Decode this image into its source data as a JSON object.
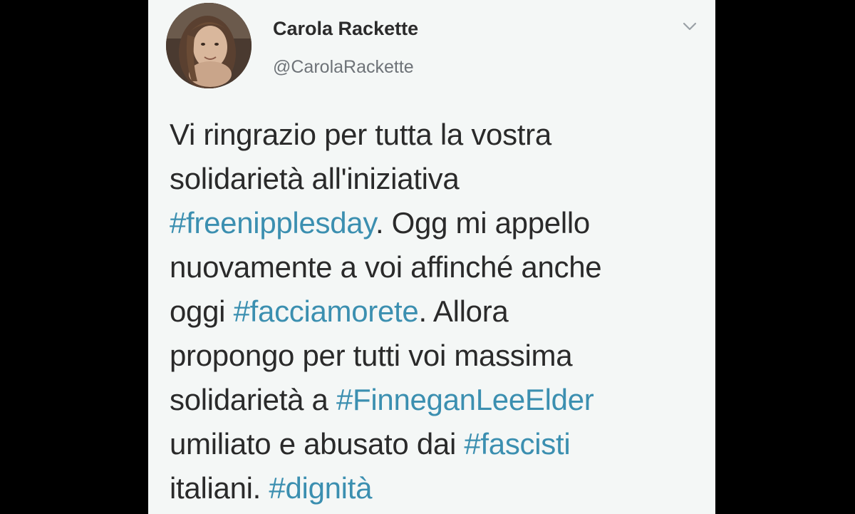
{
  "tweet": {
    "author": {
      "display_name": "Carola Rackette",
      "handle": "@CarolaRackette"
    },
    "lines": [
      [
        {
          "text": "Vi ringrazio per tutta la vostra"
        }
      ],
      [
        {
          "text": "solidarietà all'iniziativa"
        }
      ],
      [
        {
          "text": "#freenipplesday",
          "hashtag": true
        },
        {
          "text": ". Ogg mi appello"
        }
      ],
      [
        {
          "text": "nuovamente a voi affinché anche"
        }
      ],
      [
        {
          "text": "oggi "
        },
        {
          "text": "#facciamorete",
          "hashtag": true
        },
        {
          "text": ". Allora"
        }
      ],
      [
        {
          "text": "propongo per tutti voi massima"
        }
      ],
      [
        {
          "text": "solidarietà a "
        },
        {
          "text": "#FinneganLeeElder",
          "hashtag": true
        }
      ],
      [
        {
          "text": "umiliato e abusato dai "
        },
        {
          "text": "#fascisti",
          "hashtag": true
        }
      ],
      [
        {
          "text": "italiani. "
        },
        {
          "text": "#dignità",
          "hashtag": true
        }
      ]
    ]
  },
  "icons": {
    "menu": "chevron-down-icon",
    "avatar": "profile-photo"
  },
  "colors": {
    "card_background": "#f4f7f6",
    "outer_background": "#000000",
    "text": "#2a2a2a",
    "handle": "#6e7378",
    "hashtag": "#3b8fb0"
  }
}
